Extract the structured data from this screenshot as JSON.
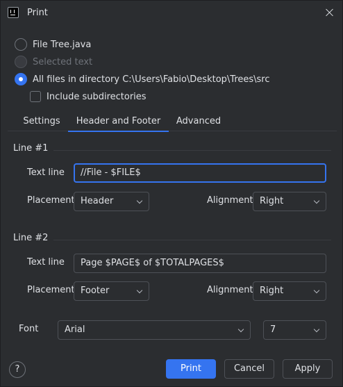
{
  "window": {
    "title": "Print",
    "app_icon": "intellij-icon",
    "close_icon": "close-icon"
  },
  "scope": {
    "options": [
      {
        "label": "File Tree.java",
        "checked": false,
        "enabled": true
      },
      {
        "label": "Selected text",
        "checked": false,
        "enabled": false
      },
      {
        "label": "All files in directory C:\\Users\\Fabio\\Desktop\\Trees\\src",
        "checked": true,
        "enabled": true
      }
    ],
    "include_subdirectories": {
      "label": "Include subdirectories",
      "checked": false
    }
  },
  "tabs": [
    {
      "label": "Settings",
      "active": false
    },
    {
      "label": "Header and Footer",
      "active": true
    },
    {
      "label": "Advanced",
      "active": false
    }
  ],
  "line1": {
    "title": "Line #1",
    "text_line_label": "Text line",
    "text_line_value": "//File - $FILE$",
    "placement_label": "Placement",
    "placement_value": "Header",
    "alignment_label": "Alignment",
    "alignment_value": "Right"
  },
  "line2": {
    "title": "Line #2",
    "text_line_label": "Text line",
    "text_line_value": "Page $PAGE$ of $TOTALPAGES$",
    "placement_label": "Placement",
    "placement_value": "Footer",
    "alignment_label": "Alignment",
    "alignment_value": "Right"
  },
  "font": {
    "label": "Font",
    "family_value": "Arial",
    "size_value": "7"
  },
  "buttons": {
    "help": "?",
    "print": "Print",
    "cancel": "Cancel",
    "apply": "Apply"
  },
  "colors": {
    "background": "#2b2d30",
    "accent": "#3574f0",
    "text": "#dfe1e5",
    "border": "#4e5157"
  }
}
